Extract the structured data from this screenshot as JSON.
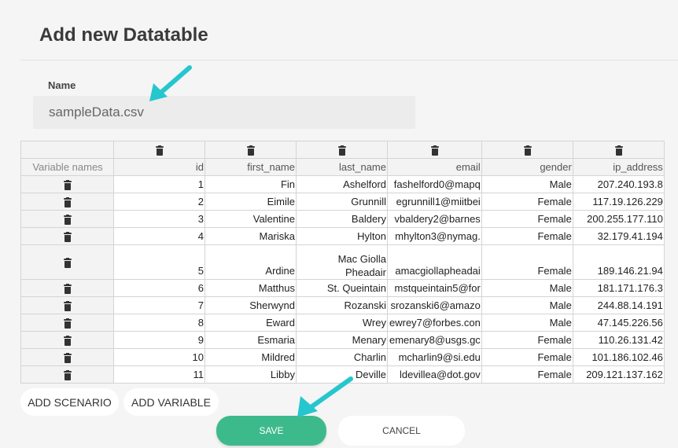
{
  "dialog": {
    "title": "Add new Datatable",
    "name_label": "Name",
    "name_value": "sampleData.csv"
  },
  "table": {
    "row_header_label": "Variable names",
    "columns": [
      "id",
      "first_name",
      "last_name",
      "email",
      "gender",
      "ip_address"
    ],
    "rows": [
      [
        "1",
        "Fin",
        "Ashelford",
        "fashelford0@mapq",
        "Male",
        "207.240.193.8"
      ],
      [
        "2",
        "Eimile",
        "Grunnill",
        "egrunnill1@miitbei",
        "Female",
        "117.19.126.229"
      ],
      [
        "3",
        "Valentine",
        "Baldery",
        "vbaldery2@barnes",
        "Female",
        "200.255.177.110"
      ],
      [
        "4",
        "Mariska",
        "Hylton",
        "mhylton3@nymag.",
        "Female",
        "32.179.41.194"
      ],
      [
        "5",
        "Ardine",
        "Mac Giolla Pheadair",
        "amacgiollapheadai",
        "Female",
        "189.146.21.94"
      ],
      [
        "6",
        "Matthus",
        "St. Queintain",
        "mstqueintain5@for",
        "Male",
        "181.171.176.3"
      ],
      [
        "7",
        "Sherwynd",
        "Rozanski",
        "srozanski6@amazo",
        "Male",
        "244.88.14.191"
      ],
      [
        "8",
        "Eward",
        "Wrey",
        "ewrey7@forbes.con",
        "Male",
        "47.145.226.56"
      ],
      [
        "9",
        "Esmaria",
        "Menary",
        "emenary8@usgs.gc",
        "Female",
        "110.26.131.42"
      ],
      [
        "10",
        "Mildred",
        "Charlin",
        "mcharlin9@si.edu",
        "Female",
        "101.186.102.46"
      ],
      [
        "11",
        "Libby",
        "Deville",
        "ldevillea@dot.gov",
        "Female",
        "209.121.137.162"
      ]
    ]
  },
  "buttons": {
    "add_scenario": "ADD SCENARIO",
    "add_variable": "ADD VARIABLE",
    "save": "SAVE",
    "cancel": "CANCEL"
  },
  "colors": {
    "save_button": "#3dba8c",
    "annotation_arrow": "#26c6cf"
  },
  "icons": {
    "delete": "trash-icon",
    "annotation": "arrow-icon"
  }
}
